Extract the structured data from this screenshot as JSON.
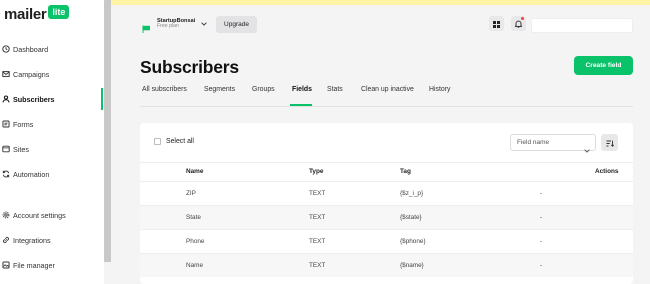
{
  "app": {
    "logo_text": "mailer",
    "logo_badge": "lite"
  },
  "sidebar": {
    "items": [
      {
        "label": "Dashboard",
        "icon": "clock-icon"
      },
      {
        "label": "Campaigns",
        "icon": "envelope-icon"
      },
      {
        "label": "Subscribers",
        "icon": "person-icon",
        "active": true
      },
      {
        "label": "Forms",
        "icon": "forms-icon"
      },
      {
        "label": "Sites",
        "icon": "globe-icon"
      },
      {
        "label": "Automation",
        "icon": "refresh-icon"
      },
      {
        "label": "Account settings",
        "icon": "gear-icon"
      },
      {
        "label": "Integrations",
        "icon": "link-icon"
      },
      {
        "label": "File manager",
        "icon": "file-manager-icon"
      }
    ]
  },
  "topbar": {
    "account_name": "StartupBonsai",
    "account_plan": "Free plan",
    "upgrade_label": "Upgrade"
  },
  "page": {
    "title": "Subscribers",
    "create_label": "Create field"
  },
  "tabs": [
    {
      "label": "All subscribers"
    },
    {
      "label": "Segments"
    },
    {
      "label": "Groups"
    },
    {
      "label": "Fields",
      "active": true
    },
    {
      "label": "Stats"
    },
    {
      "label": "Clean up inactive"
    },
    {
      "label": "History"
    }
  ],
  "table": {
    "select_all_label": "Select all",
    "sort_dropdown_value": "Field name",
    "headers": {
      "name": "Name",
      "type": "Type",
      "tag": "Tag",
      "actions": "Actions"
    },
    "rows": [
      {
        "name": "ZIP",
        "type": "TEXT",
        "tag": "{$z_i_p}",
        "actions": "-"
      },
      {
        "name": "State",
        "type": "TEXT",
        "tag": "{$state}",
        "actions": "-"
      },
      {
        "name": "Phone",
        "type": "TEXT",
        "tag": "{$phone}",
        "actions": "-"
      },
      {
        "name": "Name",
        "type": "TEXT",
        "tag": "{$name}",
        "actions": "-"
      }
    ]
  },
  "colors": {
    "brand_green": "#09c269",
    "announcement_yellow": "#fff3a6",
    "notification_red": "#e5483d"
  }
}
